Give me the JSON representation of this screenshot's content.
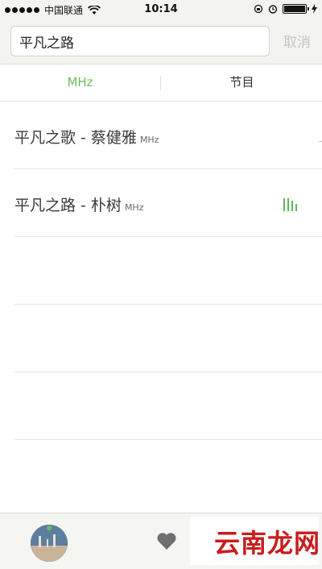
{
  "status_bar": {
    "carrier": "中国联通",
    "time": "10:14"
  },
  "search": {
    "value": "平凡之路",
    "cancel_label": "取消"
  },
  "tabs": [
    {
      "label": "MHz",
      "active": true
    },
    {
      "label": "节目",
      "active": false
    }
  ],
  "results": [
    {
      "title": "平凡之歌 - 蔡健雅",
      "unit": "MHz",
      "playing": false
    },
    {
      "title": "平凡之路 - 朴树",
      "unit": "MHz",
      "playing": true
    }
  ],
  "colors": {
    "accent": "#6cbb5a",
    "header_bg": "#f3f4f0",
    "cancel_text": "#c5c5c0",
    "watermark": "#c81d1d"
  },
  "watermark": {
    "text": "云南龙网"
  }
}
